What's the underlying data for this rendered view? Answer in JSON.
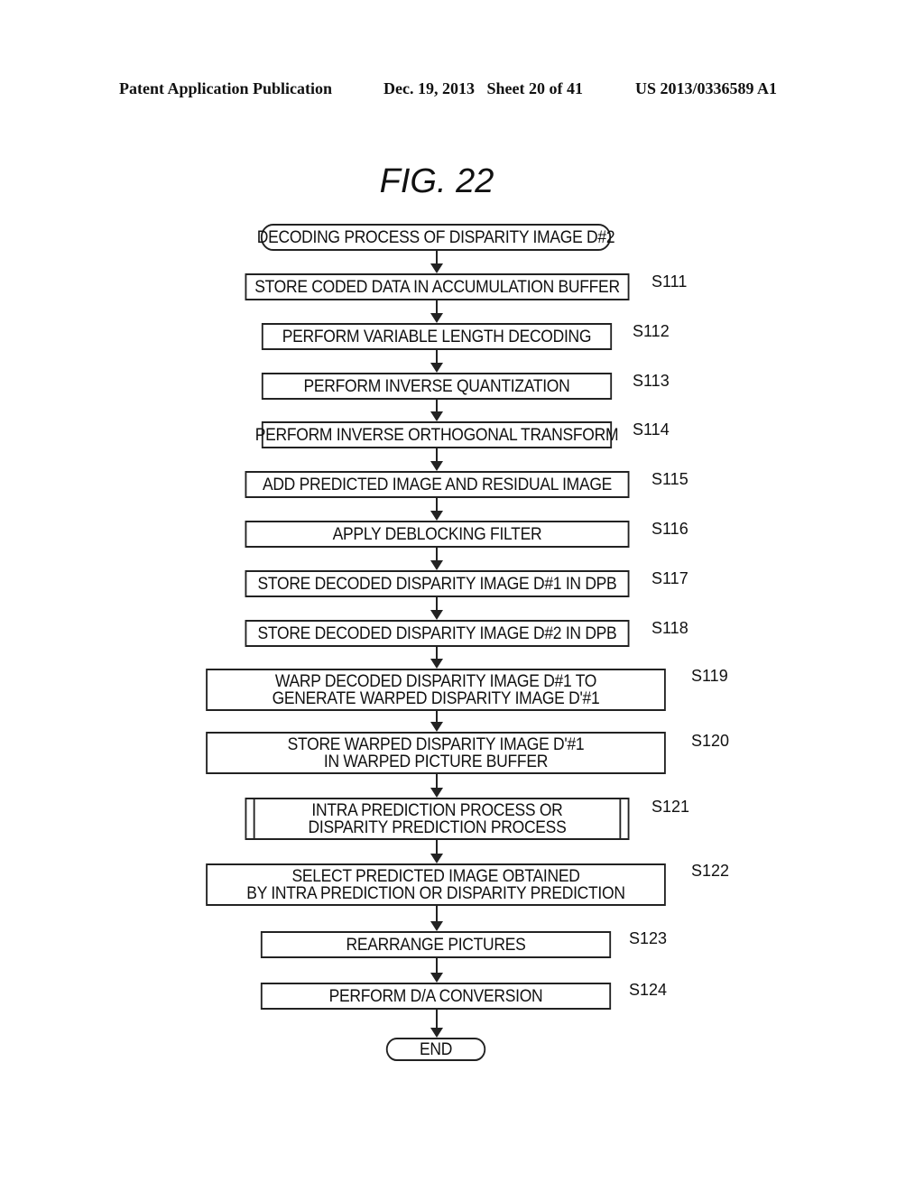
{
  "header": {
    "publication": "Patent Application Publication",
    "date_sheet": "Dec. 19, 2013   Sheet 20 of 41",
    "patent_number": "US 2013/0336589 A1"
  },
  "figure": {
    "title": "FIG. 22",
    "start": "DECODING PROCESS OF DISPARITY IMAGE D#2",
    "end": "END",
    "steps": [
      {
        "id": "S111",
        "text": "STORE CODED DATA IN ACCUMULATION BUFFER"
      },
      {
        "id": "S112",
        "text": "PERFORM VARIABLE LENGTH DECODING"
      },
      {
        "id": "S113",
        "text": "PERFORM INVERSE QUANTIZATION"
      },
      {
        "id": "S114",
        "text": "PERFORM INVERSE ORTHOGONAL TRANSFORM"
      },
      {
        "id": "S115",
        "text": "ADD PREDICTED IMAGE AND RESIDUAL IMAGE"
      },
      {
        "id": "S116",
        "text": "APPLY DEBLOCKING FILTER"
      },
      {
        "id": "S117",
        "text": "STORE DECODED DISPARITY IMAGE D#1 IN DPB"
      },
      {
        "id": "S118",
        "text": "STORE DECODED DISPARITY IMAGE D#2 IN DPB"
      },
      {
        "id": "S119",
        "text": "WARP DECODED DISPARITY IMAGE D#1 TO\nGENERATE WARPED DISPARITY IMAGE D'#1"
      },
      {
        "id": "S120",
        "text": "STORE WARPED DISPARITY IMAGE D'#1\nIN WARPED PICTURE BUFFER"
      },
      {
        "id": "S121",
        "text": "INTRA PREDICTION PROCESS OR\nDISPARITY PREDICTION PROCESS"
      },
      {
        "id": "S122",
        "text": "SELECT PREDICTED IMAGE OBTAINED\nBY INTRA PREDICTION OR DISPARITY PREDICTION"
      },
      {
        "id": "S123",
        "text": "REARRANGE PICTURES"
      },
      {
        "id": "S124",
        "text": "PERFORM D/A CONVERSION"
      }
    ]
  }
}
